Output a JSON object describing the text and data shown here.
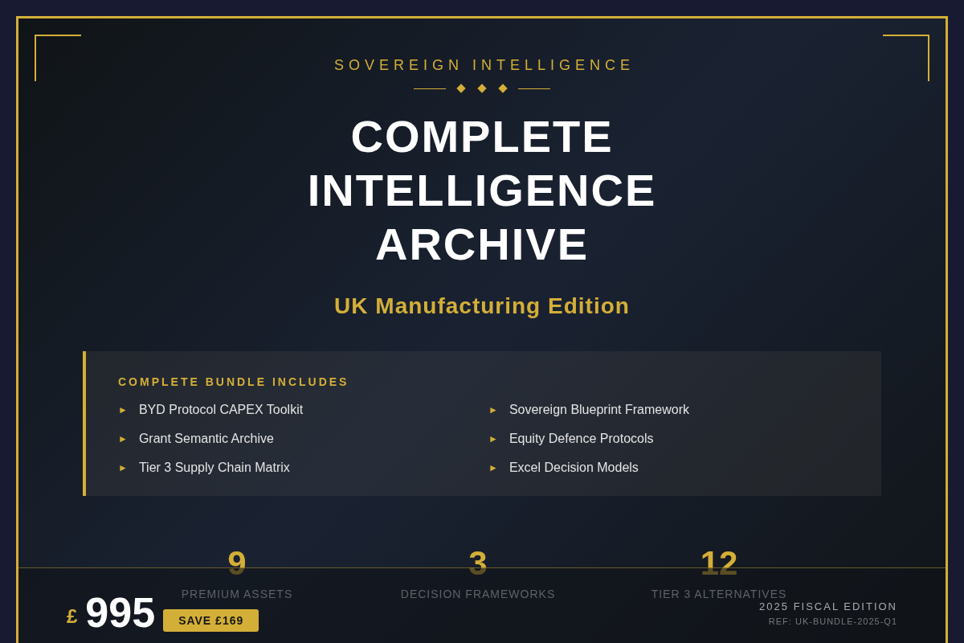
{
  "header": {
    "eyebrow": "SOVEREIGN INTELLIGENCE",
    "title_lines": [
      "COMPLETE",
      "INTELLIGENCE",
      "ARCHIVE"
    ],
    "subtitle": "UK Manufacturing Edition"
  },
  "bundle": {
    "heading": "COMPLETE BUNDLE INCLUDES",
    "items": [
      {
        "marker": "►",
        "label": "BYD Protocol CAPEX Toolkit"
      },
      {
        "marker": "►",
        "label": "Sovereign Blueprint Framework"
      },
      {
        "marker": "►",
        "label": "Grant Semantic Archive"
      },
      {
        "marker": "►",
        "label": "Equity Defence Protocols"
      },
      {
        "marker": "►",
        "label": "Tier 3 Supply Chain Matrix"
      },
      {
        "marker": "►",
        "label": "Excel Decision Models"
      }
    ]
  },
  "stats": [
    {
      "value": "9",
      "label": "PREMIUM ASSETS"
    },
    {
      "value": "3",
      "label": "DECISION FRAMEWORKS"
    },
    {
      "value": "12",
      "label": "TIER 3 ALTERNATIVES"
    }
  ],
  "footer": {
    "currency": "£",
    "price": "995",
    "badge": "SAVE £169",
    "edition": "2025 FISCAL EDITION",
    "ref": "REF: UK-BUNDLE-2025-Q1"
  }
}
